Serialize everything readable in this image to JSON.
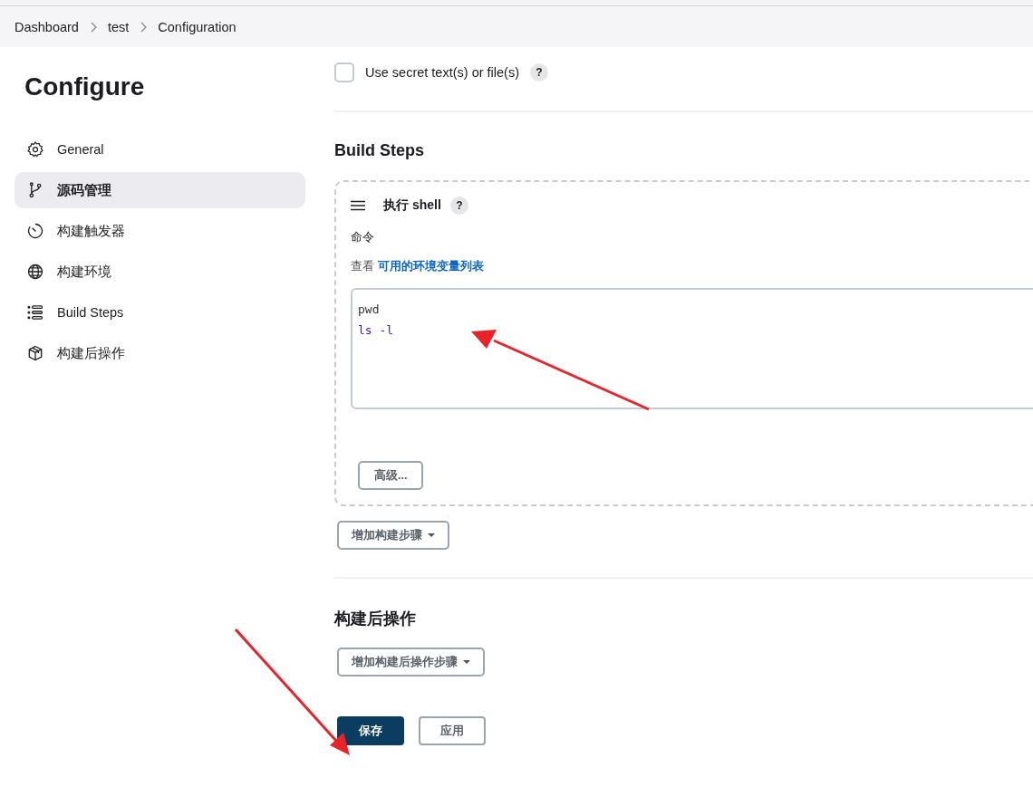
{
  "breadcrumbs": [
    "Dashboard",
    "test",
    "Configuration"
  ],
  "sidebar": {
    "title": "Configure",
    "items": [
      {
        "label": "General",
        "selected": false
      },
      {
        "label": "源码管理",
        "selected": true
      },
      {
        "label": "构建触发器",
        "selected": false
      },
      {
        "label": "构建环境",
        "selected": false
      },
      {
        "label": "Build Steps",
        "selected": false
      },
      {
        "label": "构建后操作",
        "selected": false
      }
    ]
  },
  "secret_option": {
    "label": "Use secret text(s) or file(s)",
    "checked": false,
    "help": "?"
  },
  "build_steps": {
    "heading": "Build Steps",
    "step": {
      "title": "执行 shell",
      "help": "?",
      "command_label": "命令",
      "env_prefix": "查看",
      "env_link": "可用的环境变量列表",
      "command_lines": [
        {
          "text": "pwd",
          "color": "#333333"
        },
        {
          "text": "ls -l",
          "color": "#3a1ac8"
        }
      ],
      "advanced_button": "高级..."
    },
    "add_button": "增加构建步骤"
  },
  "post_build": {
    "heading": "构建后操作",
    "add_button": "增加构建后操作步骤"
  },
  "actions": [
    {
      "label": "保存",
      "primary": true
    },
    {
      "label": "应用",
      "primary": false
    }
  ]
}
